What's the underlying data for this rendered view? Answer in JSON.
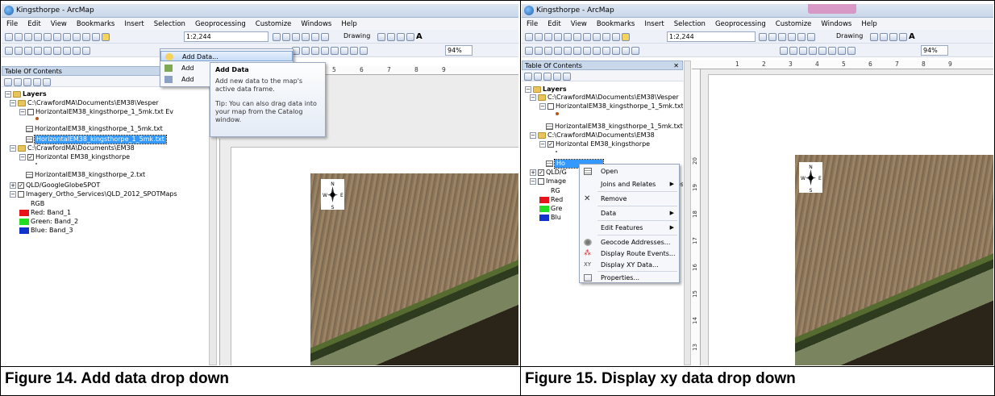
{
  "figures": {
    "left_caption": "Figure 14. Add data drop down",
    "right_caption": "Figure 15. Display xy data drop down"
  },
  "app": {
    "title": "Kingsthorpe - ArcMap",
    "menu": [
      "File",
      "Edit",
      "View",
      "Bookmarks",
      "Insert",
      "Selection",
      "Geoprocessing",
      "Customize",
      "Windows",
      "Help"
    ],
    "scale": "1:2,244",
    "drawing_label": "Drawing",
    "zoom": "94%"
  },
  "toc": {
    "header": "Table Of Contents",
    "close": "✕",
    "pin": "q",
    "layers": "Layers",
    "vesper_path": "C:\\CrawfordMA\\Documents\\EM38\\Vesper",
    "vesper_events_left": "HorizontalEM38_kingsthorpe_1_5mk.txt Ev",
    "vesper_events_right": "HorizontalEM38_kingsthorpe_1_5mk.txt Events",
    "vesper_table_left": "HorizontalEM38_kingsthorpe_1_5mk.txt",
    "vesper_table_right": "HorizontalEM38_kingsthorpe_1_5mk.txt",
    "em38_path": "C:\\CrawfordMA\\Documents\\EM38",
    "horizontal_layer": "Horizontal EM38_kingsthorpe",
    "horizontal_table": "HorizontalEM38_kingsthorpe_2.txt",
    "selected_partial": "Ho",
    "qld_layer": "QLD/GoogleGlobeSPOT",
    "qld_partial": "QLD/G",
    "imagery_layer": "Imagery_Ortho_Services\\QLD_2012_SPOTMaps",
    "imagery_partial": "Image",
    "maps_suffix": "Maps",
    "rgb": "RGB",
    "rgb_partial": "RG",
    "red": "Red:   Band_1",
    "green": "Green: Band_2",
    "blue": "Blue:  Band_3",
    "red_partial": "Red",
    "green_partial": "Gre",
    "blue_partial": "Blu"
  },
  "add_data_menu": {
    "items": [
      "Add Data...",
      "Add",
      "Add"
    ]
  },
  "add_data_tooltip": {
    "title": "Add Data",
    "body": "Add new data to the map's active data frame.",
    "tip": "Tip: You can also drag data into your map from the Catalog window."
  },
  "context_menu": {
    "items": [
      {
        "label": "Open",
        "icon": "table-icon",
        "arrow": false
      },
      {
        "label": "Joins and Relates",
        "icon": "",
        "arrow": true
      },
      {
        "label": "Remove",
        "icon": "remove-icon",
        "arrow": false
      },
      {
        "label": "Data",
        "icon": "",
        "arrow": true
      },
      {
        "label": "Edit Features",
        "icon": "",
        "arrow": true
      },
      {
        "label": "Geocode Addresses...",
        "icon": "geocode-icon",
        "arrow": false
      },
      {
        "label": "Display Route Events...",
        "icon": "route-icon",
        "arrow": false
      },
      {
        "label": "Display XY Data...",
        "icon": "xy-icon",
        "arrow": false
      },
      {
        "label": "Properties...",
        "icon": "properties-icon",
        "arrow": false
      }
    ]
  },
  "ruler": {
    "left_h": [
      "1",
      "2",
      "3",
      "4",
      "5",
      "6",
      "7",
      "8",
      "9"
    ],
    "left_v": [
      "20",
      "19",
      "18",
      "17",
      "16",
      "15",
      "14",
      "13",
      "12"
    ],
    "right_h": [
      "1",
      "2",
      "3",
      "4",
      "5",
      "6",
      "7",
      "8",
      "9"
    ],
    "right_v": [
      "20",
      "19",
      "18",
      "17",
      "16",
      "15",
      "14",
      "13",
      "12",
      "11",
      "10",
      "9"
    ]
  },
  "compass": {
    "n": "N",
    "s": "S",
    "e": "E",
    "w": "W"
  },
  "colors": {
    "red": "#e8141c",
    "green": "#22dd22",
    "blue": "#1133cc",
    "selection": "#3399ff"
  }
}
